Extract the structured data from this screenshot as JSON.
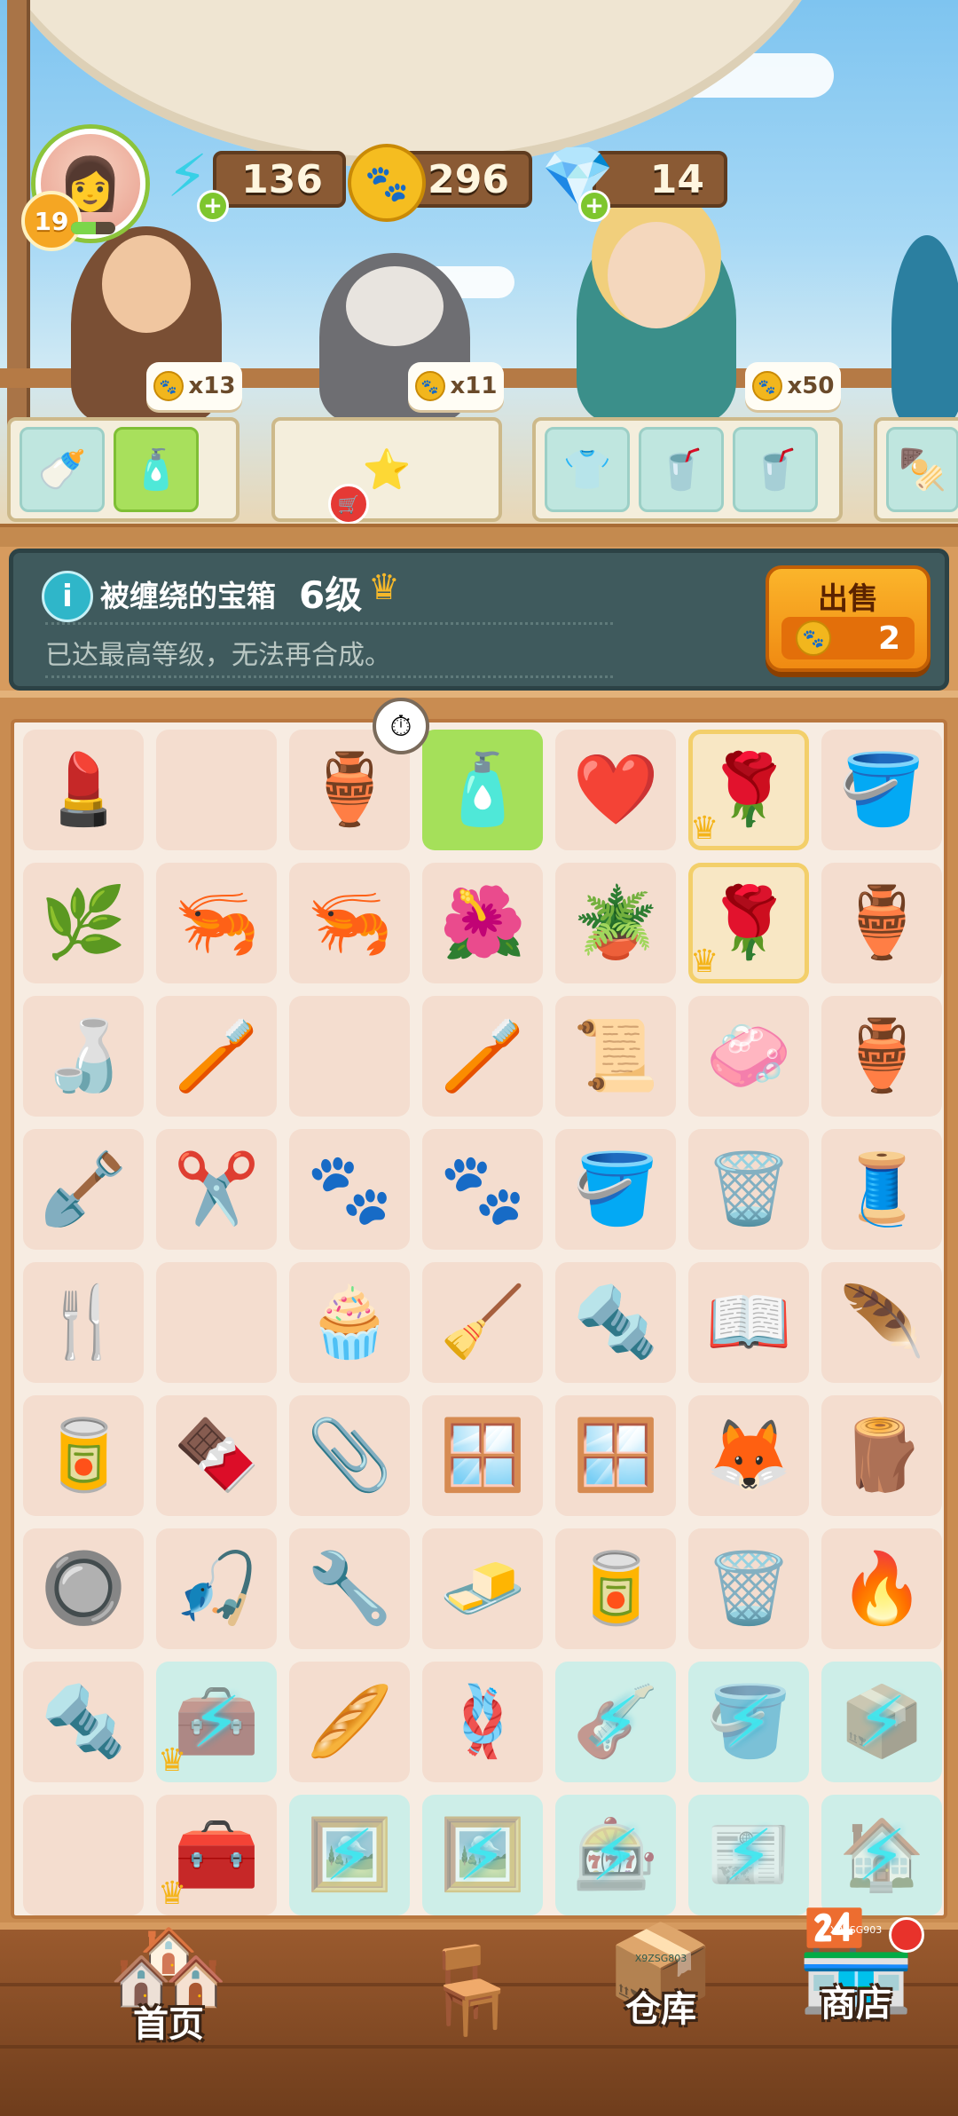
{
  "hud": {
    "player_level": "19",
    "xp_fraction": 0.55,
    "energy": "136",
    "paws": "296",
    "gems": "14",
    "energy_icon": "lightning-icon",
    "paw_icon": "paw-coin-icon",
    "gem_icon": "diamond-icon"
  },
  "customers": [
    {
      "name": "old-sailor",
      "reward": "x13",
      "orders": [
        "🍼",
        "🧴"
      ]
    },
    {
      "name": "raccoon",
      "reward": "x11",
      "orders": [
        "⭐"
      ]
    },
    {
      "name": "blonde-woman",
      "reward": "x50",
      "orders": [
        "👕",
        "🥤",
        "🥤"
      ]
    }
  ],
  "info": {
    "title": "被缠绕的宝箱",
    "level": "6级",
    "description": "已达最高等级，无法再合成。",
    "sell_label": "出售",
    "sell_price": "2"
  },
  "board": {
    "rows": [
      [
        "💄",
        "",
        "🏺",
        "🧴",
        "❤️",
        "🌹",
        "🪣"
      ],
      [
        "🌿",
        "🦐",
        "🦐",
        "🌺",
        "🪴",
        "🌹",
        "🏺"
      ],
      [
        "🍶",
        "🪥",
        "",
        "🪥",
        "📜",
        "🧼",
        "🏺"
      ],
      [
        "🪏",
        "✂️",
        "🐾",
        "🐾",
        "🪣",
        "🗑️",
        "🧵"
      ],
      [
        "🍴",
        "",
        "🧁",
        "🧹",
        "🔩",
        "📖",
        "🪶"
      ],
      [
        "🥫",
        "🍫",
        "📎",
        "🪟",
        "🪟",
        "🦊",
        "🪵"
      ],
      [
        "🔘",
        "🎣",
        "🔧",
        "🧈",
        "🥫",
        "🗑️",
        "🔥"
      ],
      [
        "🔩",
        "🧰",
        "🥖",
        "🪢",
        "🎸",
        "🪣",
        "📦"
      ],
      [
        "",
        "🧰",
        "🖼️",
        "🖼️",
        "🎰",
        "📰",
        "🏠"
      ]
    ]
  },
  "nav": {
    "home": "首页",
    "warehouse": "仓库",
    "shop": "商店",
    "shop_sign": "X9ZSG903",
    "warehouse_sign": "X9ZSG803"
  }
}
